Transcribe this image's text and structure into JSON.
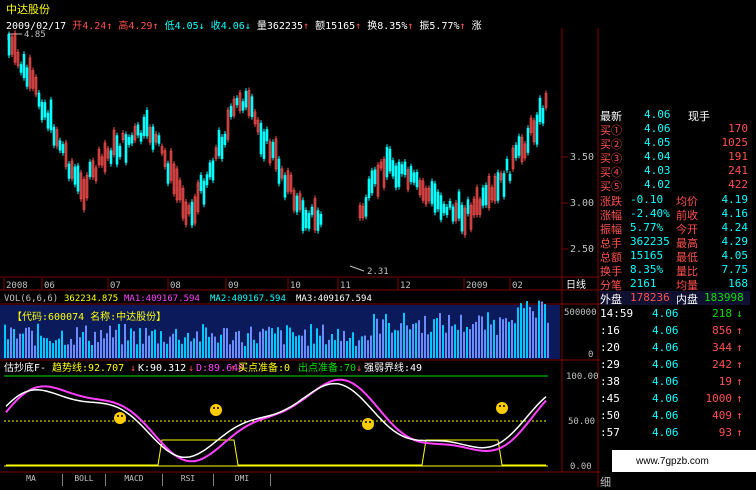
{
  "header": {
    "title": "中达股份"
  },
  "info_bar": {
    "date": "2009/02/17",
    "open_label": "开",
    "open": "4.24",
    "high_label": "高",
    "high": "4.29",
    "low_label": "低",
    "low": "4.05",
    "close_label": "收",
    "close": "4.06",
    "vol_label": "量",
    "vol": "362235",
    "amt_label": "额",
    "amt": "15165",
    "turn_label": "换",
    "turn": "8.35%",
    "amp_label": "振",
    "amp": "5.77%",
    "more": "涨"
  },
  "price_chart": {
    "high_marker": "4.85",
    "low_marker": "2.31",
    "yticks": [
      "3.50",
      "3.00",
      "2.50"
    ],
    "xticks": [
      "2008",
      "06",
      "07",
      "08",
      "09",
      "10",
      "11",
      "12",
      "2009",
      "02"
    ],
    "period": "日线"
  },
  "volume_panel": {
    "header": "VOL(6,6,6)",
    "vol": "362234.875",
    "ma1": "MA1:409167.594",
    "ma2": "MA2:409167.594",
    "ma3": "MA3:409167.594",
    "code_label": "【代码:600074 名称:中达股份】",
    "yticks": [
      "500000",
      "0"
    ]
  },
  "indicator_panel": {
    "name": "估抄底F-",
    "trend": "趋势线:92.707",
    "k": "K:90.312",
    "d": "D:89.648",
    "buy_ready": "买点准备:0",
    "sell_ready": "出点准备:70",
    "strong_weak": "强弱界线:49",
    "yticks": [
      "100.00",
      "50.00",
      "0.00"
    ]
  },
  "tabs": [
    "MA",
    "BOLL",
    "MACD",
    "RSI",
    "DMI"
  ],
  "quote": {
    "latest_label": "最新",
    "latest": "4.06",
    "side_label": "现手",
    "bids": [
      {
        "label": "买①",
        "price": "4.06",
        "vol": "170"
      },
      {
        "label": "买②",
        "price": "4.05",
        "vol": "1025"
      },
      {
        "label": "买③",
        "price": "4.04",
        "vol": "191"
      },
      {
        "label": "买④",
        "price": "4.03",
        "vol": "241"
      },
      {
        "label": "买⑤",
        "price": "4.02",
        "vol": "422"
      }
    ],
    "stats": [
      {
        "k1": "涨跌",
        "v1": "-0.10",
        "k2": "均价",
        "v2": "4.19"
      },
      {
        "k1": "涨幅",
        "v1": "-2.40%",
        "k2": "前收",
        "v2": "4.16"
      },
      {
        "k1": "振幅",
        "v1": "5.77%",
        "k2": "今开",
        "v2": "4.24"
      },
      {
        "k1": "总手",
        "v1": "362235",
        "k2": "最高",
        "v2": "4.29"
      },
      {
        "k1": "总额",
        "v1": "15165",
        "k2": "最低",
        "v2": "4.05"
      },
      {
        "k1": "换手",
        "v1": "8.35%",
        "k2": "量比",
        "v2": "7.75"
      },
      {
        "k1": "分笔",
        "v1": "2161",
        "k2": "均量",
        "v2": "168"
      }
    ],
    "outer_label": "外盘",
    "outer": "178236",
    "inner_label": "内盘",
    "inner": "183998",
    "ticks": [
      {
        "t": "14:59",
        "p": "4.06",
        "v": "218",
        "d": "↓"
      },
      {
        "t": ":16",
        "p": "4.06",
        "v": "856",
        "d": "↑"
      },
      {
        "t": ":20",
        "p": "4.06",
        "v": "344",
        "d": "↑"
      },
      {
        "t": ":29",
        "p": "4.06",
        "v": "242",
        "d": "↑"
      },
      {
        "t": ":38",
        "p": "4.06",
        "v": "19",
        "d": "↑"
      },
      {
        "t": ":45",
        "p": "4.06",
        "v": "1000",
        "d": "↑"
      },
      {
        "t": ":50",
        "p": "4.06",
        "v": "409",
        "d": "↑"
      },
      {
        "t": ":57",
        "p": "4.06",
        "v": "93",
        "d": "↑"
      }
    ],
    "footer": "细"
  },
  "watermark": "www.7gpzb.com",
  "colors": {
    "up": "#ff5050",
    "down": "#00ffff",
    "grid": "#800000",
    "k": "#ff40ff",
    "d": "#ffffff",
    "trend": "#ffffff"
  }
}
